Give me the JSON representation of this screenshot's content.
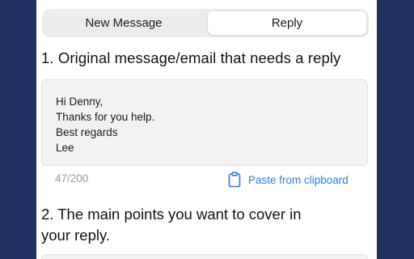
{
  "tabs": [
    {
      "label": "New Message",
      "active": false
    },
    {
      "label": "Reply",
      "active": true
    }
  ],
  "section1": {
    "heading": "1. Original message/email that needs a reply",
    "message_lines": [
      "Hi Denny,",
      "Thanks for you help.",
      "Best regards",
      "Lee"
    ],
    "counter": "47/200",
    "paste_label": "Paste from clipboard",
    "paste_icon": "clipboard-icon"
  },
  "section2": {
    "heading_lines": [
      "2. The main points you want to cover in",
      "your reply."
    ]
  },
  "colors": {
    "background": "#1f3160",
    "accent": "#2f7be6",
    "panel": "#ffffff",
    "field": "#f2f2f3"
  }
}
